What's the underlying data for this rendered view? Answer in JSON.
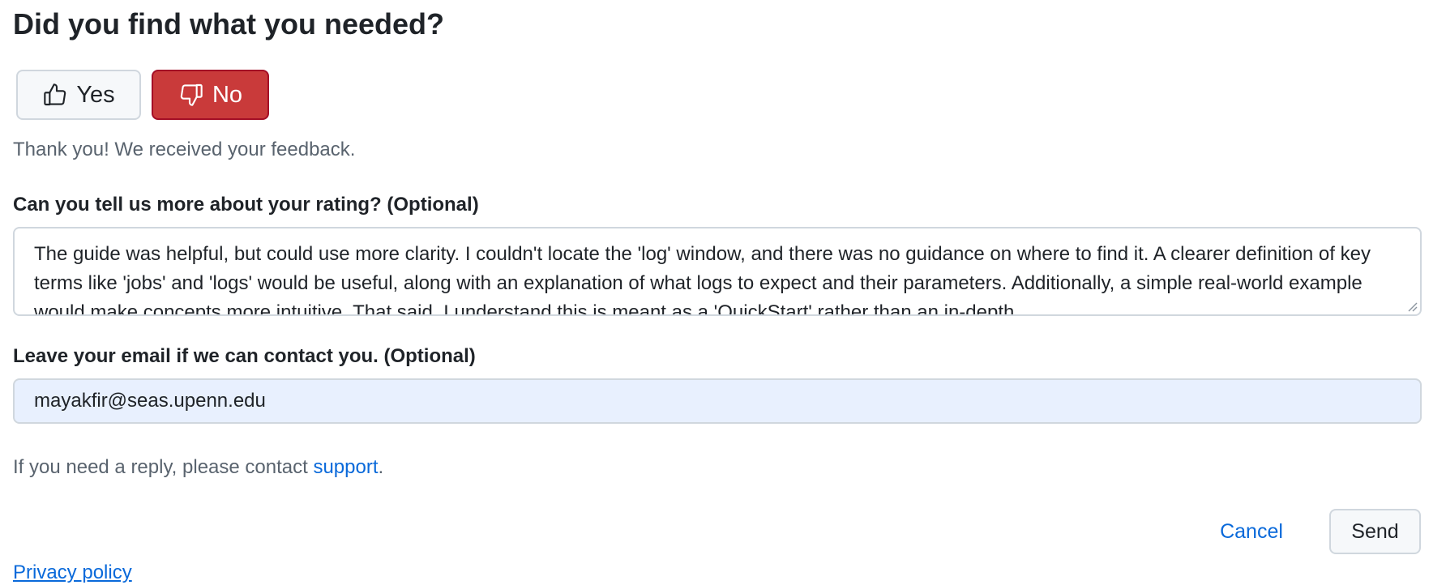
{
  "heading": "Did you find what you needed?",
  "rating": {
    "yes_label": "Yes",
    "no_label": "No",
    "selected": "No",
    "yes_icon": "thumbs-up-icon",
    "no_icon": "thumbs-down-icon"
  },
  "confirmation": "Thank you! We received your feedback.",
  "details": {
    "label": "Can you tell us more about your rating? (Optional)",
    "value": "The guide was helpful, but could use more clarity. I couldn't locate the 'log' window, and there was no guidance on where to find it. A clearer definition of key terms like 'jobs' and 'logs' would be useful, along with an explanation of what logs to expect and their parameters. Additionally, a simple real-world example would make concepts more intuitive. That said, I understand this is meant as a 'QuickStart' rather than an in-depth"
  },
  "email": {
    "label": "Leave your email if we can contact you. (Optional)",
    "value": "mayakfir@seas.upenn.edu"
  },
  "reply_note": {
    "prefix": "If you need a reply, please contact ",
    "link_text": "support",
    "suffix": "."
  },
  "actions": {
    "cancel_label": "Cancel",
    "send_label": "Send"
  },
  "footer": {
    "privacy_label": "Privacy policy"
  },
  "colors": {
    "no_button_bg": "#c93a3a",
    "link": "#0969da",
    "email_field_bg": "#e8f0fe"
  }
}
